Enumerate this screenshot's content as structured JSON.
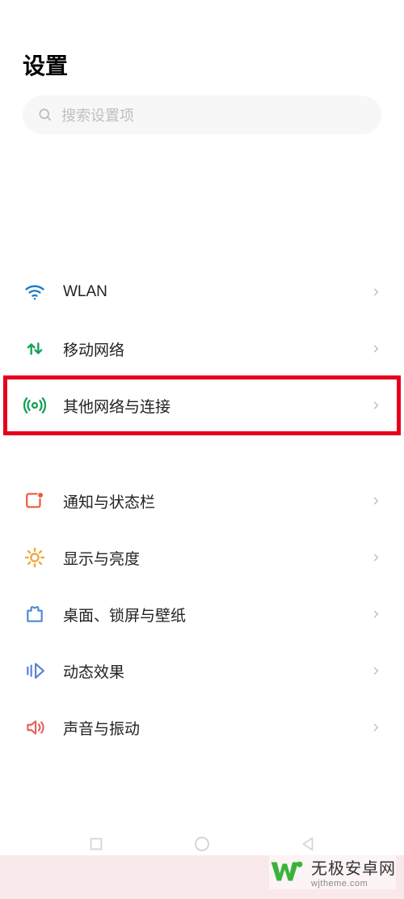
{
  "header": {
    "title": "设置"
  },
  "search": {
    "placeholder": "搜索设置项"
  },
  "group1": [
    {
      "key": "wlan",
      "label": "WLAN",
      "icon": "wifi",
      "color": "#1b7ac6"
    },
    {
      "key": "mobile",
      "label": "移动网络",
      "icon": "arrows",
      "color": "#17a05a"
    },
    {
      "key": "other-network",
      "label": "其他网络与连接",
      "icon": "broadcast",
      "color": "#17a05a",
      "highlight": true
    }
  ],
  "group2": [
    {
      "key": "notification",
      "label": "通知与状态栏",
      "icon": "badge",
      "color": "#e85a3a"
    },
    {
      "key": "display",
      "label": "显示与亮度",
      "icon": "sun",
      "color": "#f2a53c"
    },
    {
      "key": "desktop",
      "label": "桌面、锁屏与壁纸",
      "icon": "shirt",
      "color": "#4a8cd6"
    },
    {
      "key": "motion",
      "label": "动态效果",
      "icon": "motion",
      "color": "#5a7fd6"
    },
    {
      "key": "sound",
      "label": "声音与振动",
      "icon": "speaker",
      "color": "#e86060"
    }
  ],
  "nav": {
    "square": "square",
    "circle": "circle",
    "triangle": "triangle"
  },
  "watermark": {
    "main": "无极安卓网",
    "sub": "wjtheme.com"
  }
}
